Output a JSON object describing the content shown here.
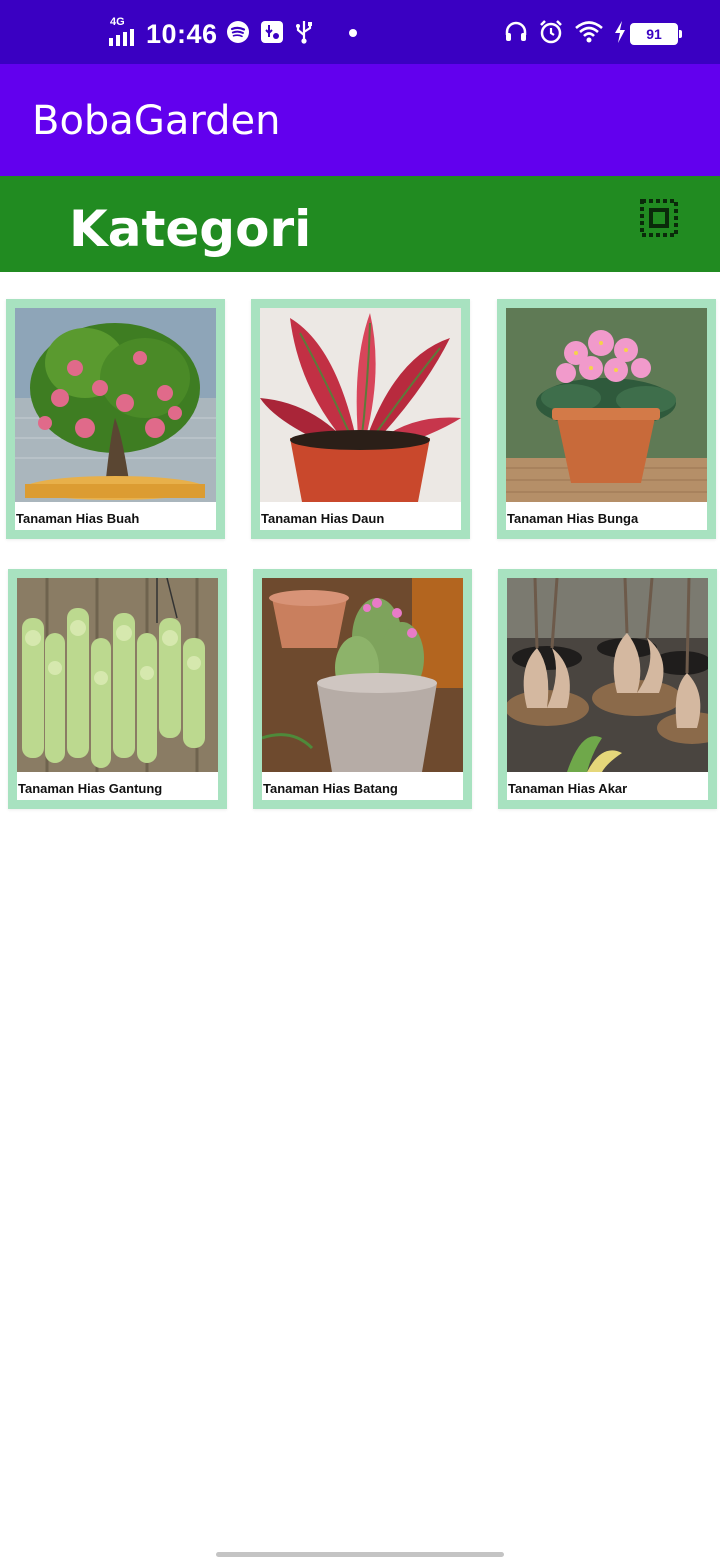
{
  "status_bar": {
    "network": "4G",
    "time": "10:46",
    "battery": "91"
  },
  "app_bar": {
    "title": "BobaGarden"
  },
  "category_header": {
    "title": "Kategori"
  },
  "categories": [
    {
      "label": "Tanaman Hias Buah"
    },
    {
      "label": "Tanaman Hias Daun"
    },
    {
      "label": "Tanaman Hias Bunga"
    },
    {
      "label": "Tanaman Hias Gantung"
    },
    {
      "label": "Tanaman Hias Batang"
    },
    {
      "label": "Tanaman Hias Akar"
    }
  ],
  "colors": {
    "status_bar": "#3a00c2",
    "app_bar": "#6200ee",
    "category_bar": "#218b21",
    "card_border": "#a8e2c0"
  }
}
